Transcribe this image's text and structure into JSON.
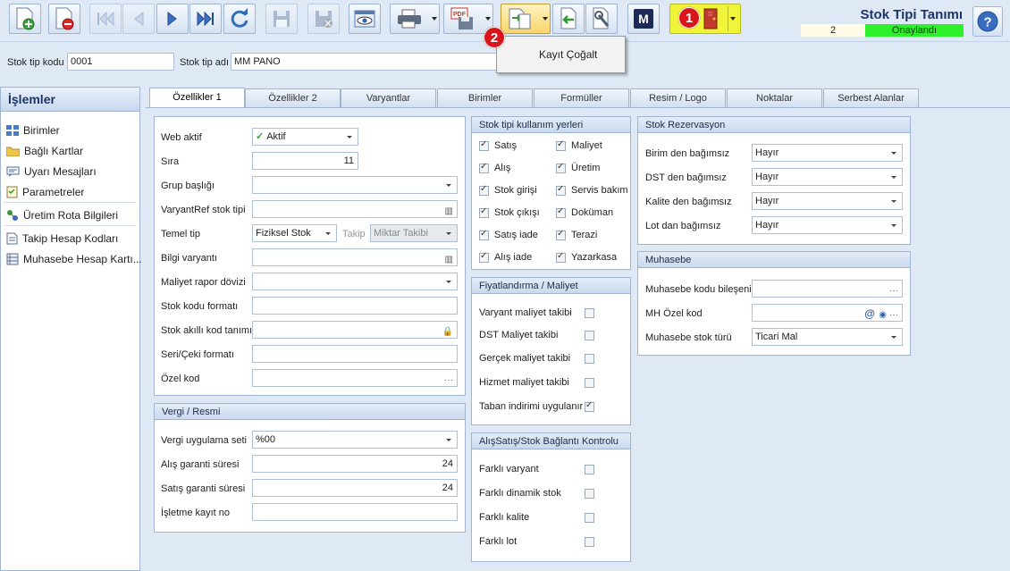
{
  "window": {
    "title": "Stok Tipi Tanımı",
    "status_number": "2",
    "status_text": "Onaylandı"
  },
  "toolbar": {
    "badge1": "1",
    "badge2": "2",
    "m_label": "M"
  },
  "popup": {
    "item": "Kayıt Çoğalt"
  },
  "header": {
    "code_label": "Stok tip kodu",
    "code_value": "0001",
    "name_label": "Stok tip adı",
    "name_value": "MM PANO"
  },
  "sidebar": {
    "title": "İşlemler",
    "items": [
      {
        "label": "Birimler",
        "icon": "grid-icon"
      },
      {
        "label": "Bağlı Kartlar",
        "icon": "folder-icon"
      },
      {
        "label": "Uyarı Mesajları",
        "icon": "message-icon"
      },
      {
        "label": "Parametreler",
        "icon": "checklist-icon"
      },
      {
        "label": "Üretim Rota Bilgileri",
        "icon": "route-icon"
      },
      {
        "label": "Takip Hesap Kodları",
        "icon": "document-icon"
      },
      {
        "label": "Muhasebe Hesap Kartı...",
        "icon": "ledger-icon"
      }
    ]
  },
  "tabs": [
    "Özellikler 1",
    "Özellikler 2",
    "Varyantlar",
    "Birimler",
    "Formüller",
    "Resim / Logo",
    "Noktalar",
    "Serbest Alanlar"
  ],
  "props": {
    "web_aktif_label": "Web aktif",
    "web_aktif_value": "Aktif",
    "sira_label": "Sıra",
    "sira_value": "11",
    "grup_label": "Grup başlığı",
    "varyantref_label": "VaryantRef stok tipi",
    "temel_label": "Temel tip",
    "temel_value": "Fiziksel Stok",
    "takip_label": "Takip",
    "takip_value": "Miktar Takibi",
    "bilgi_label": "Bilgi varyantı",
    "maliyet_label": "Maliyet rapor dövizi",
    "stokkodu_label": "Stok kodu formatı",
    "akilli_label": "Stok akıllı kod tanımı",
    "seri_label": "Seri/Çeki formatı",
    "ozel_label": "Özel kod"
  },
  "vergi": {
    "title": "Vergi / Resmi",
    "set_label": "Vergi uygulama seti",
    "set_value": "%00",
    "alis_label": "Alış garanti süresi",
    "alis_value": "24",
    "satis_label": "Satış garanti süresi",
    "satis_value": "24",
    "isletme_label": "İşletme kayıt no"
  },
  "kullanim": {
    "title": "Stok tipi kullanım yerleri",
    "left": [
      "Satış",
      "Alış",
      "Stok girişi",
      "Stok çıkışı",
      "Satış iade",
      "Alış iade"
    ],
    "right": [
      "Maliyet",
      "Üretim",
      "Servis bakım",
      "Doküman",
      "Terazi",
      "Yazarkasa"
    ]
  },
  "fiyat": {
    "title": "Fiyatlandırma / Maliyet",
    "items": [
      "Varyant maliyet takibi",
      "DST Maliyet takibi",
      "Gerçek maliyet takibi",
      "Hizmet maliyet takibi",
      "Taban indirimi uygulanır"
    ],
    "checked": [
      false,
      false,
      false,
      false,
      true
    ]
  },
  "baglanti": {
    "title": "AlışSatış/Stok Bağlantı Kontrolu",
    "items": [
      "Farklı varyant",
      "Farklı dinamik stok",
      "Farklı kalite",
      "Farklı lot"
    ]
  },
  "rezervasyon": {
    "title": "Stok Rezervasyon",
    "items": [
      {
        "label": "Birim den bağımsız",
        "value": "Hayır"
      },
      {
        "label": "DST den bağımsız",
        "value": "Hayır"
      },
      {
        "label": "Kalite den bağımsız",
        "value": "Hayır"
      },
      {
        "label": "Lot dan bağımsız",
        "value": "Hayır"
      }
    ]
  },
  "muhasebe": {
    "title": "Muhasebe",
    "kod_label": "Muhasebe kodu bileşeni",
    "mh_label": "MH Özel kod",
    "tur_label": "Muhasebe stok türü",
    "tur_value": "Ticari Mal"
  },
  "colors": {
    "accent": "#1c3566",
    "status_green": "#2ef02a",
    "badge_red": "#d9141b"
  }
}
